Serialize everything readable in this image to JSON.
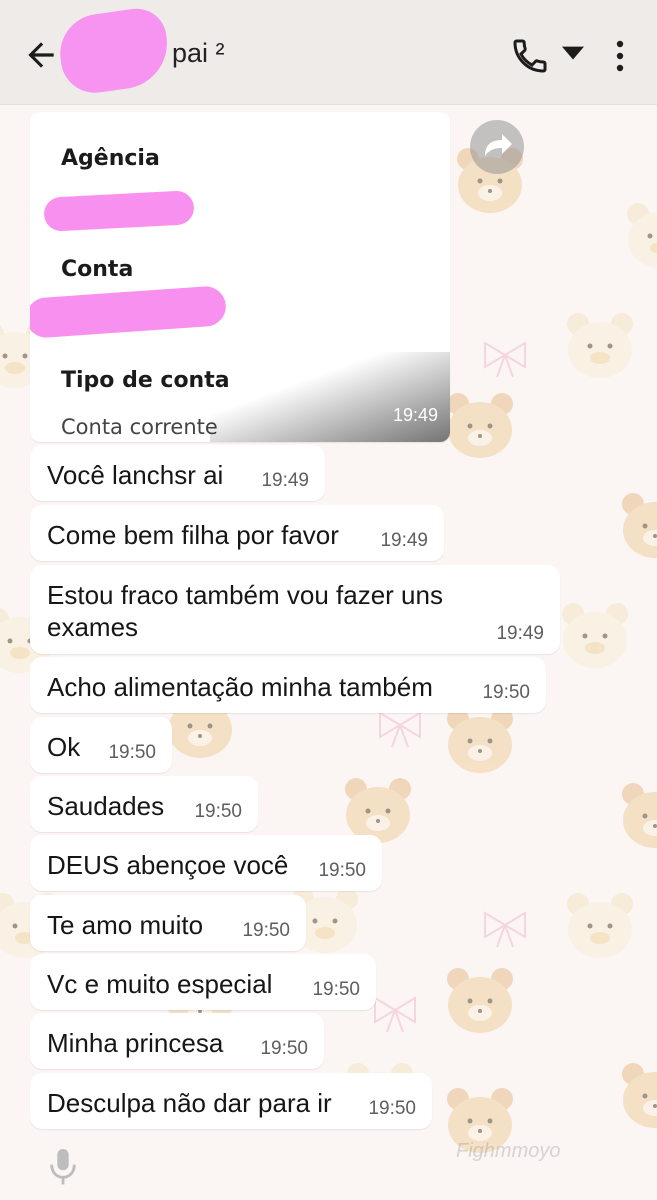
{
  "header": {
    "contact_name": "pai ²"
  },
  "shared_image": {
    "fields": [
      {
        "label": "Agência",
        "value": ""
      },
      {
        "label": "Conta",
        "value": ""
      },
      {
        "label": "Tipo de conta",
        "value": "Conta corrente"
      }
    ],
    "time": "19:49"
  },
  "messages": [
    {
      "text": "Você lanchsr ai",
      "time": "19:49"
    },
    {
      "text": "Come bem filha por favor",
      "time": "19:49"
    },
    {
      "text": "Estou fraco também vou fazer uns exames",
      "time": "19:49"
    },
    {
      "text": "Acho alimentação minha também",
      "time": "19:50"
    },
    {
      "text": "Ok",
      "time": "19:50"
    },
    {
      "text": "Saudades",
      "time": "19:50"
    },
    {
      "text": "DEUS abençoe você",
      "time": "19:50"
    },
    {
      "text": "Te amo muito",
      "time": "19:50"
    },
    {
      "text": "Vc e muito especial",
      "time": "19:50"
    },
    {
      "text": "Minha princesa",
      "time": "19:50"
    },
    {
      "text": "Desculpa não dar para ir",
      "time": "19:50"
    }
  ],
  "wallpaper_text": "Fighmmoyo",
  "colors": {
    "header_bg": "#efebe8",
    "bubble_bg": "#ffffff",
    "redaction": "#f890f0",
    "wallpaper_bg": "#fbf5f3"
  },
  "icons": [
    "back-arrow-icon",
    "phone-icon",
    "dropdown-arrow-icon",
    "more-vert-icon",
    "forward-icon",
    "mic-icon"
  ]
}
